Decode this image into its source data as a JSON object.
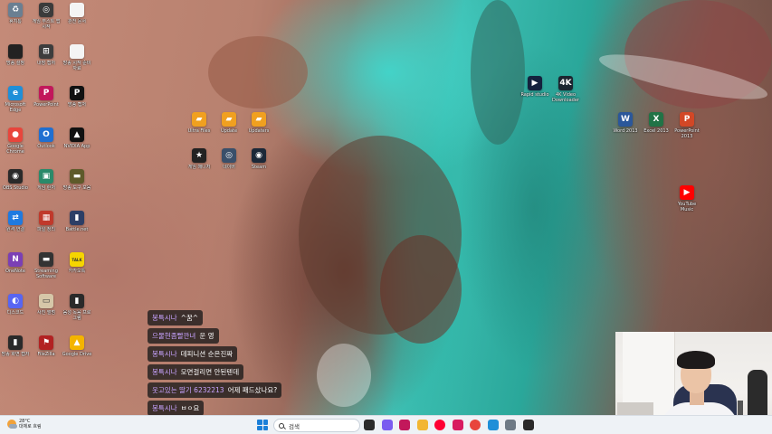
{
  "desktop": {
    "icons_left": [
      {
        "label": "휴지통",
        "icon": "recycle-bin-icon",
        "color": "#6a7f92",
        "glyph": "♻"
      },
      {
        "label": "게임 부스트 앱 시작",
        "icon": "game-boost-icon",
        "color": "#3b3b3b",
        "glyph": "◎"
      },
      {
        "label": "관전 문서",
        "icon": "document-icon",
        "color": "#f4f4f4",
        "glyph": ""
      },
      {
        "label": "방송 설정",
        "icon": "monitor-icon",
        "color": "#222222",
        "glyph": ""
      },
      {
        "label": "내장 캡처",
        "icon": "capture-icon",
        "color": "#3d3d3d",
        "glyph": "⊞"
      },
      {
        "label": "방송 시작 준비 자료",
        "icon": "document-icon",
        "color": "#f4f4f4",
        "glyph": ""
      },
      {
        "label": "Microsoft Edge",
        "icon": "edge-icon",
        "color": "#1f8fd8",
        "glyph": "e"
      },
      {
        "label": "PowerPoint",
        "icon": "app-icon",
        "color": "#c2185b",
        "glyph": "P"
      },
      {
        "label": "방송 캡처",
        "icon": "capture-icon",
        "color": "#111111",
        "glyph": "P"
      },
      {
        "label": "Google Chrome",
        "icon": "chrome-icon",
        "color": "#e8453c",
        "glyph": "●"
      },
      {
        "label": "Outlook",
        "icon": "outlook-icon",
        "color": "#1f6fd1",
        "glyph": "O"
      },
      {
        "label": "NVIDIA App",
        "icon": "nvidia-icon",
        "color": "#111111",
        "glyph": "▲"
      },
      {
        "label": "OBS Studio",
        "icon": "obs-icon",
        "color": "#2a2a2a",
        "glyph": "◉"
      },
      {
        "label": "게임 런처",
        "icon": "launcher-icon",
        "color": "#2a8a6a",
        "glyph": "▣"
      },
      {
        "label": "방송 도구 모음",
        "icon": "tools-icon",
        "color": "#5e5a2a",
        "glyph": "▬"
      },
      {
        "label": "원격 연결",
        "icon": "remote-icon",
        "color": "#1f7ae0",
        "glyph": "⇄"
      },
      {
        "label": "파일 정리",
        "icon": "app-icon",
        "color": "#c0392b",
        "glyph": "▦"
      },
      {
        "label": "Battle.net",
        "icon": "app-icon",
        "color": "#2c3e66",
        "glyph": "▮"
      },
      {
        "label": "OneNote",
        "icon": "onenote-icon",
        "color": "#7b3fb5",
        "glyph": "N"
      },
      {
        "label": "Streaming Software",
        "icon": "stream-icon",
        "color": "#333333",
        "glyph": "▬"
      },
      {
        "label": "카카오톡",
        "icon": "kakaotalk-icon",
        "color": "#f6d500",
        "glyph": "TALK"
      },
      {
        "label": "디스코드",
        "icon": "discord-icon",
        "color": "#5865f2",
        "glyph": "◐"
      },
      {
        "label": "사진 앨범",
        "icon": "photo-icon",
        "color": "#d6c7a8",
        "glyph": "▭"
      },
      {
        "label": "음성 녹음 프로그램",
        "icon": "app-icon",
        "color": "#2a2a2a",
        "glyph": "▮"
      },
      {
        "label": "방송 화면 캡처",
        "icon": "capture-icon",
        "color": "#2a2a2a",
        "glyph": "▮"
      },
      {
        "label": "FileZilla",
        "icon": "app-icon",
        "color": "#b22222",
        "glyph": "⚑"
      },
      {
        "label": "Google Drive",
        "icon": "drive-icon",
        "color": "#f4b400",
        "glyph": "▲"
      }
    ],
    "icons_center": [
      {
        "label": "Ultra Files",
        "icon": "folder-hat-icon",
        "color": "#f0a020",
        "glyph": "▰"
      },
      {
        "label": "Update",
        "icon": "folder-hat-icon",
        "color": "#f0a020",
        "glyph": "▰"
      },
      {
        "label": "Updaters",
        "icon": "folder-hat-icon",
        "color": "#f0a020",
        "glyph": "▰"
      },
      {
        "label": "게임 매니저",
        "icon": "game-manager-icon",
        "color": "#222222",
        "glyph": "★"
      },
      {
        "label": "네이버",
        "icon": "app-icon",
        "color": "#3a4f6a",
        "glyph": "◎"
      },
      {
        "label": "Steam",
        "icon": "steam-icon",
        "color": "#1b2838",
        "glyph": "◉"
      }
    ],
    "icons_right": [
      {
        "label": "Rapid studio",
        "icon": "player-icon",
        "color": "#14213d",
        "glyph": "▶"
      },
      {
        "label": "4K Video Downloader",
        "icon": "4k-icon",
        "color": "#1c2530",
        "glyph": "4K"
      },
      {
        "label": "Word 2013",
        "icon": "word-icon",
        "color": "#2b579a",
        "glyph": "W"
      },
      {
        "label": "Excel 2013",
        "icon": "excel-icon",
        "color": "#217346",
        "glyph": "X"
      },
      {
        "label": "PowerPoint 2013",
        "icon": "powerpoint-icon",
        "color": "#d24726",
        "glyph": "P"
      },
      {
        "label": "YouTube Music",
        "icon": "youtube-music-icon",
        "color": "#ff0000",
        "glyph": "▶"
      }
    ]
  },
  "chat": [
    {
      "nick": "봉특시나",
      "message": "^꿈^"
    },
    {
      "nick": "으물현좀빨깐녀",
      "message": "운 영"
    },
    {
      "nick": "봉특시나",
      "message": "데피니션 순은진짜"
    },
    {
      "nick": "봉특시나",
      "message": "모면걸리면 안된텐데"
    },
    {
      "nick": "웃고있는 딸기 6232213",
      "message": "어제 패드샀나요?"
    },
    {
      "nick": "봉특시나",
      "message": "ㅂㅇ요"
    }
  ],
  "taskbar": {
    "weather_temp": "28°C",
    "weather_desc": "대체로 흐림",
    "search_placeholder": "검색",
    "apps": [
      {
        "icon": "task-view-icon",
        "color": "#2b2b2b"
      },
      {
        "icon": "copilot-icon",
        "color": "#7a5cf0"
      },
      {
        "icon": "app-icon",
        "color": "#c2185b"
      },
      {
        "icon": "file-explorer-icon",
        "color": "#f2b632"
      },
      {
        "icon": "youtube-music-icon",
        "color": "#ff0033"
      },
      {
        "icon": "app-icon",
        "color": "#d81b60"
      },
      {
        "icon": "chrome-icon",
        "color": "#e8453c"
      },
      {
        "icon": "edge-icon",
        "color": "#1f8fd8"
      },
      {
        "icon": "settings-icon",
        "color": "#6e7a86"
      },
      {
        "icon": "app-icon",
        "color": "#2a2a2a"
      }
    ]
  },
  "webcam": {
    "label": "streamer-webcam"
  }
}
